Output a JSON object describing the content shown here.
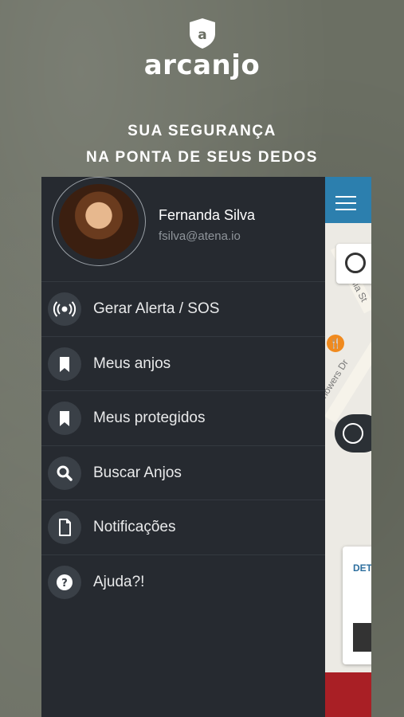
{
  "brand": {
    "logo_letter": "a",
    "name": "arcanjo"
  },
  "tagline": {
    "line1": "SUA SEGURANÇA",
    "line2": "NA PONTA DE SEUS DEDOS"
  },
  "drawer": {
    "user_name": "Fernanda Silva",
    "user_email": "fsilva@atena.io",
    "menu_items": [
      {
        "label": "Gerar Alerta / SOS",
        "icon": "broadcast-icon"
      },
      {
        "label": "Meus anjos",
        "icon": "bookmark-icon"
      },
      {
        "label": "Meus protegidos",
        "icon": "bookmark-icon"
      },
      {
        "label": "Buscar Anjos",
        "icon": "search-icon"
      },
      {
        "label": "Notificações",
        "icon": "document-icon"
      },
      {
        "label": "Ajuda?!",
        "icon": "help-icon"
      }
    ]
  },
  "map": {
    "street1": "California St",
    "street2": "Showers Dr",
    "detail_label": "DET"
  },
  "colors": {
    "drawer_bg": "#262a30",
    "header_blue": "#2c7fae",
    "alert_red": "#a91f25"
  }
}
